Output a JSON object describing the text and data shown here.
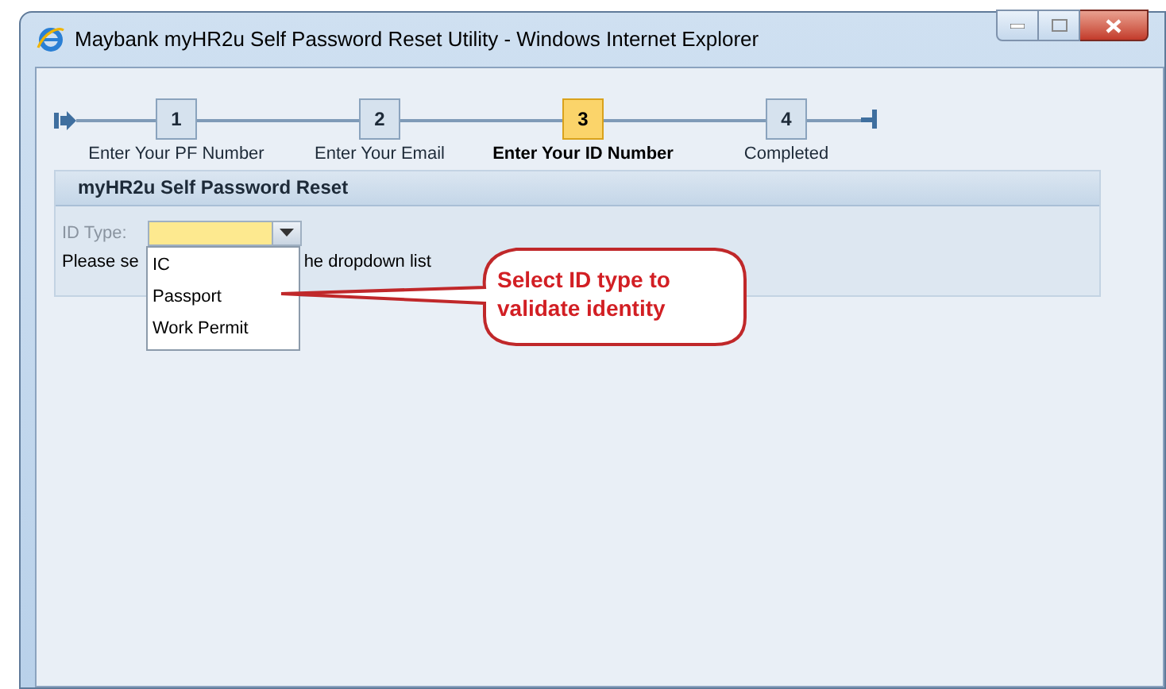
{
  "window": {
    "title": "Maybank myHR2u Self Password Reset Utility - Windows Internet Explorer"
  },
  "steps": [
    {
      "number": "1",
      "label": "Enter Your PF Number",
      "selected": false
    },
    {
      "number": "2",
      "label": "Enter Your Email",
      "selected": false
    },
    {
      "number": "3",
      "label": "Enter Your ID Number",
      "selected": true
    },
    {
      "number": "4",
      "label": "Completed",
      "selected": false
    }
  ],
  "panel": {
    "title": "myHR2u Self Password Reset",
    "id_type": {
      "label": "ID Type:",
      "options": [
        "IC",
        "Passport",
        "Work Permit"
      ]
    },
    "instruction_start": "Please se",
    "instruction_end": "he dropdown list"
  },
  "callout": {
    "text": "Select ID type to validate identity"
  }
}
